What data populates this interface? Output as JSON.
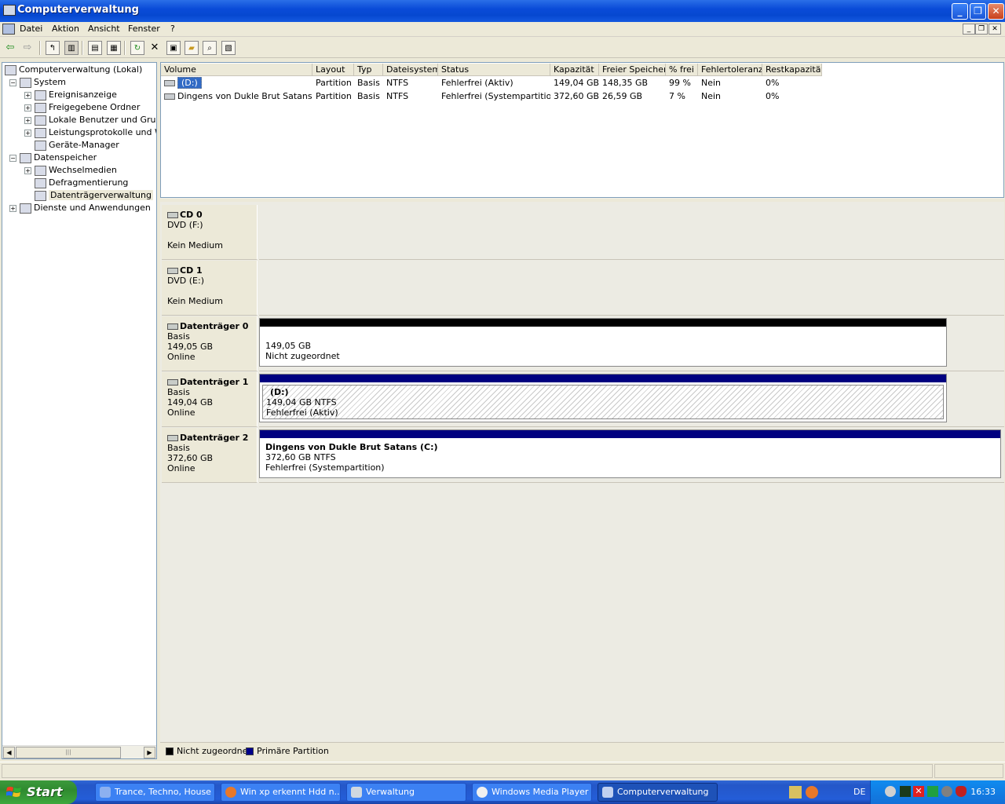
{
  "window": {
    "title": "Computerverwaltung"
  },
  "menu": {
    "items": [
      "Datei",
      "Aktion",
      "Ansicht",
      "Fenster",
      "?"
    ]
  },
  "tree": [
    {
      "label": "Computerverwaltung (Lokal)",
      "level": 0,
      "exp": ""
    },
    {
      "label": "System",
      "level": 1,
      "exp": "−"
    },
    {
      "label": "Ereignisanzeige",
      "level": 2,
      "exp": "+"
    },
    {
      "label": "Freigegebene Ordner",
      "level": 2,
      "exp": "+"
    },
    {
      "label": "Lokale Benutzer und Gruppe",
      "level": 2,
      "exp": "+"
    },
    {
      "label": "Leistungsprotokolle und War",
      "level": 2,
      "exp": "+"
    },
    {
      "label": "Geräte-Manager",
      "level": 2,
      "exp": ""
    },
    {
      "label": "Datenspeicher",
      "level": 1,
      "exp": "−"
    },
    {
      "label": "Wechselmedien",
      "level": 2,
      "exp": "+"
    },
    {
      "label": "Defragmentierung",
      "level": 2,
      "exp": ""
    },
    {
      "label": "Datenträgerverwaltung",
      "level": 2,
      "exp": "",
      "selected": true
    },
    {
      "label": "Dienste und Anwendungen",
      "level": 1,
      "exp": "+"
    }
  ],
  "volumes": {
    "headers": [
      "Volume",
      "Layout",
      "Typ",
      "Dateisystem",
      "Status",
      "Kapazität",
      "Freier Speicher",
      "% frei",
      "Fehlertoleranz",
      "Restkapazität"
    ],
    "rows": [
      [
        "(D:)",
        "Partition",
        "Basis",
        "NTFS",
        "Fehlerfrei (Aktiv)",
        "149,04 GB",
        "148,35 GB",
        "99 %",
        "Nein",
        "0%"
      ],
      [
        "Dingens von Dukle Brut Satans (C:)",
        "Partition",
        "Basis",
        "NTFS",
        "Fehlerfrei (Systempartition)",
        "372,60 GB",
        "26,59 GB",
        "7 %",
        "Nein",
        "0%"
      ]
    ]
  },
  "disks": [
    {
      "name": "CD 0",
      "line1": "DVD (F:)",
      "line2": "",
      "line3": "Kein Medium",
      "partition": null
    },
    {
      "name": "CD 1",
      "line1": "DVD (E:)",
      "line2": "",
      "line3": "Kein Medium",
      "partition": null
    },
    {
      "name": "Datenträger 0",
      "line1": "Basis",
      "line2": "149,05 GB",
      "line3": "Online",
      "partition": {
        "title": "",
        "size": "149,05 GB",
        "status": "Nicht zugeordnet",
        "type": "unallocated"
      }
    },
    {
      "name": "Datenträger 1",
      "line1": "Basis",
      "line2": "149,04 GB",
      "line3": "Online",
      "partition": {
        "title": "(D:)",
        "size": "149,04 GB NTFS",
        "status": "Fehlerfrei (Aktiv)",
        "type": "primary",
        "selected": true
      }
    },
    {
      "name": "Datenträger 2",
      "line1": "Basis",
      "line2": "372,60 GB",
      "line3": "Online",
      "partition": {
        "title": "Dingens von Dukle Brut Satans  (C:)",
        "size": "372,60 GB NTFS",
        "status": "Fehlerfrei (Systempartition)",
        "type": "primary"
      }
    }
  ],
  "legend": [
    {
      "label": "Nicht zugeordnet",
      "color": "#000000"
    },
    {
      "label": "Primäre Partition",
      "color": "#00008b"
    }
  ],
  "colors": {
    "unallocated": "#000000",
    "primary": "#000080"
  },
  "taskbar": {
    "start": "Start",
    "buttons": [
      "Trance, Techno, House",
      "Win xp erkennt Hdd n...",
      "Verwaltung",
      "Windows Media Player",
      "Computerverwaltung"
    ],
    "language": "DE",
    "clock": "16:33"
  }
}
